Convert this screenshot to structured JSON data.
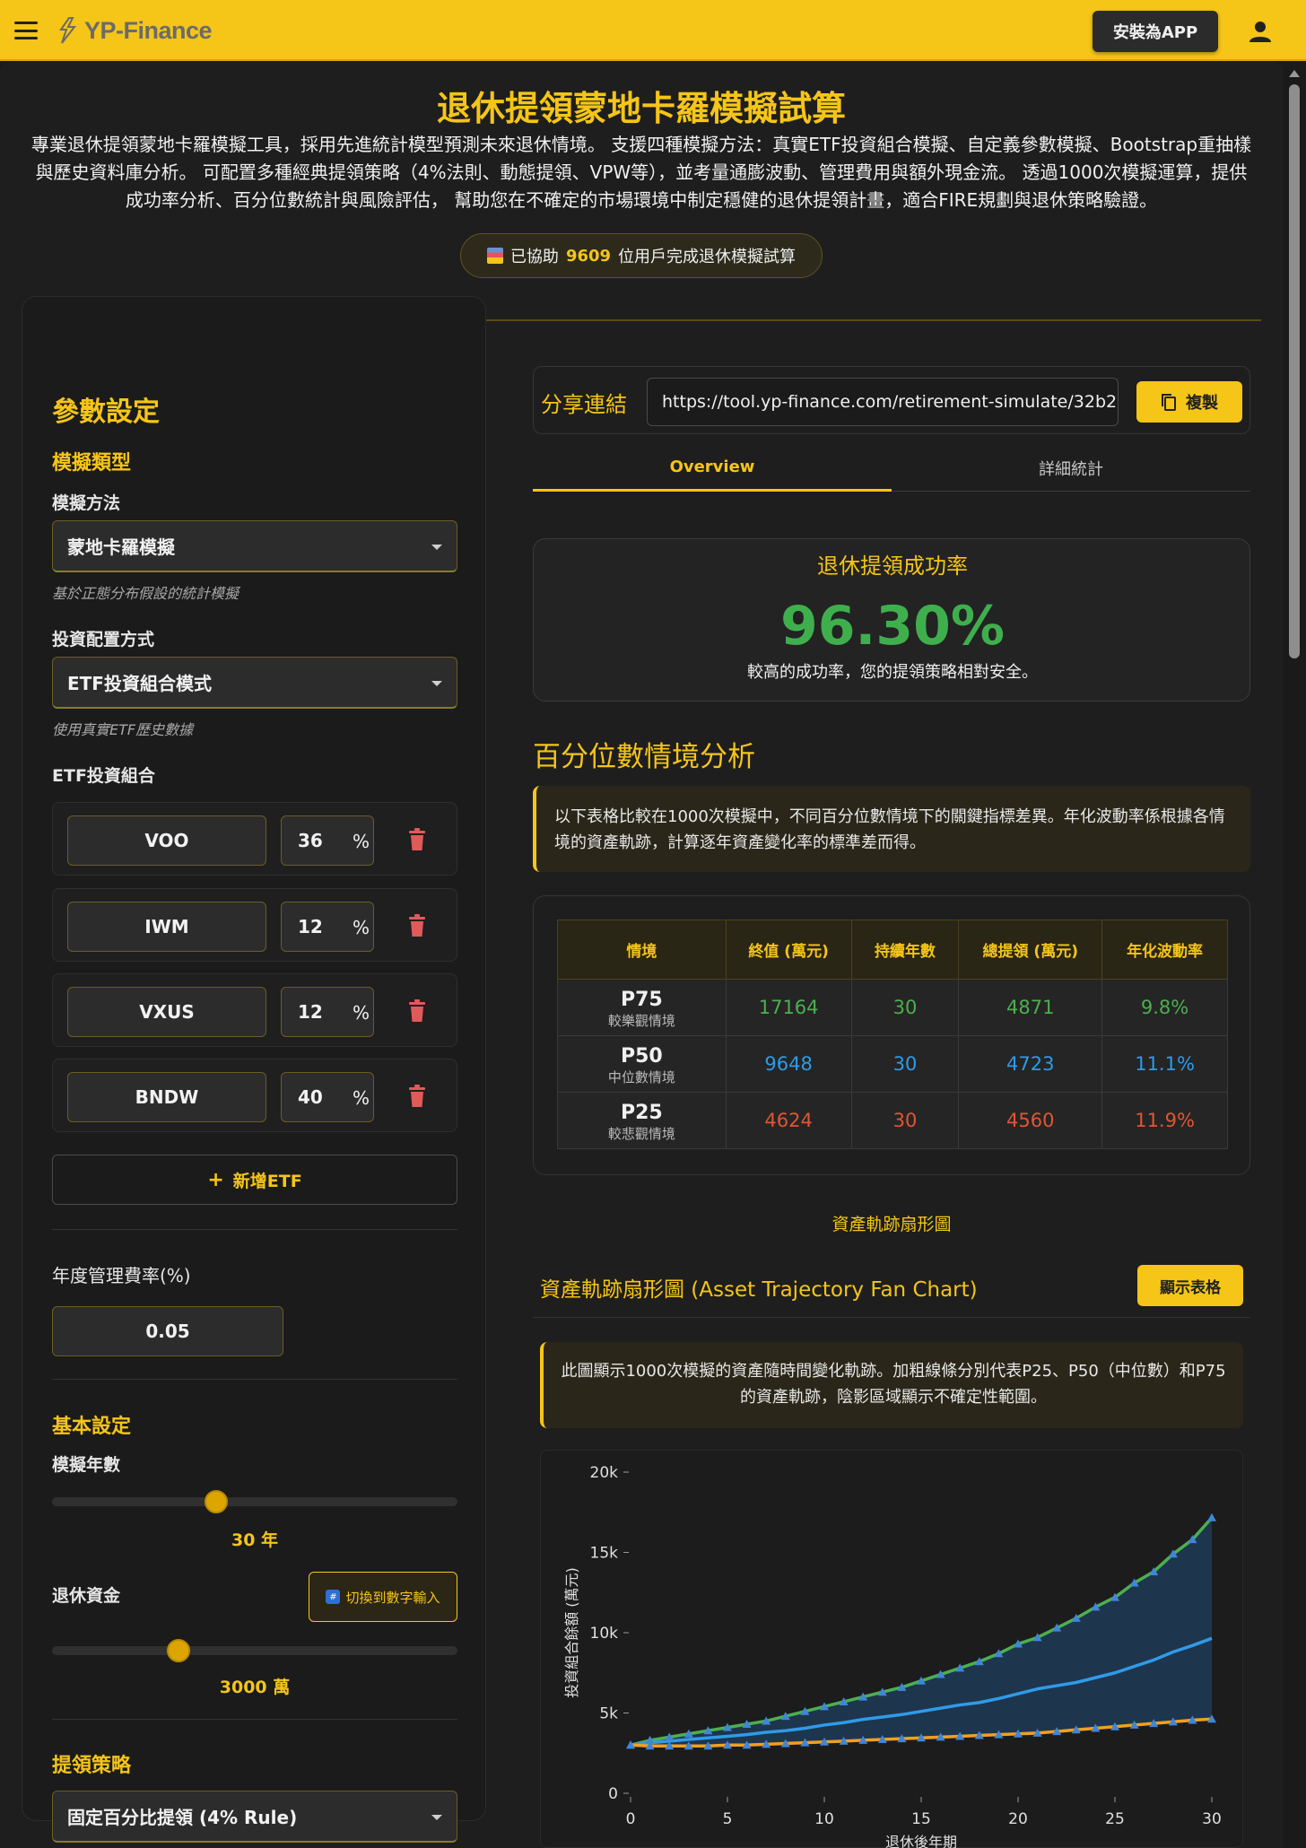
{
  "header": {
    "app_name": "YP-Finance",
    "install_label": "安裝為APP"
  },
  "intro": {
    "title": "退休提領蒙地卡羅模擬試算",
    "description": "專業退休提領蒙地卡羅模擬工具，採用先進統計模型預測未來退休情境。 支援四種模擬方法：真實ETF投資組合模擬、自定義參數模擬、Bootstrap重抽樣與歷史資料庫分析。 可配置多種經典提領策略（4%法則、動態提領、VPW等），並考量通膨波動、管理費用與額外現金流。 透過1000次模擬運算，提供成功率分析、百分位數統計與風險評估， 幫助您在不確定的市場環境中制定穩健的退休提領計畫，適合FIRE規劃與退休策略驗證。",
    "badge_prefix": "已協助",
    "badge_count": "9609",
    "badge_suffix": "位用戶完成退休模擬試算"
  },
  "params": {
    "title": "參數設定",
    "sim_type_title": "模擬類型",
    "method_label": "模擬方法",
    "method_value": "蒙地卡羅模擬",
    "method_hint": "基於正態分布假設的統計模擬",
    "alloc_label": "投資配置方式",
    "alloc_value": "ETF投資組合模式",
    "alloc_hint": "使用真實ETF歷史數據",
    "etf_label": "ETF投資組合",
    "etfs": [
      {
        "name": "VOO",
        "pct": "36"
      },
      {
        "name": "IWM",
        "pct": "12"
      },
      {
        "name": "VXUS",
        "pct": "12"
      },
      {
        "name": "BNDW",
        "pct": "40"
      }
    ],
    "pct_sign": "%",
    "add_etf_label": "新增ETF",
    "fee_label": "年度管理費率(%)",
    "fee_value": "0.05",
    "basic_title": "基本設定",
    "years_label": "模擬年數",
    "years_value": "30 年",
    "years_fraction": 0.4,
    "capital_label": "退休資金",
    "switch_label": "切換到數字輸入",
    "capital_value": "3000 萬",
    "capital_fraction": 0.3,
    "strategy_title": "提領策略",
    "strategy_value": "固定百分比提領 (4% Rule)"
  },
  "share": {
    "label": "分享連結",
    "url": "https://tool.yp-finance.com/retirement-simulate/32b2dfe",
    "copy_label": "複製"
  },
  "tabs": [
    {
      "label": "Overview"
    },
    {
      "label": "詳細統計"
    }
  ],
  "success": {
    "title": "退休提領成功率",
    "value": "96.30%",
    "note": "較高的成功率，您的提領策略相對安全。"
  },
  "percentile": {
    "title": "百分位數情境分析",
    "info": "以下表格比較在1000次模擬中，不同百分位數情境下的關鍵指標差異。年化波動率係根據各情境的資產軌跡，計算逐年資產變化率的標準差而得。",
    "headers": [
      "情境",
      "終值 (萬元)",
      "持續年數",
      "總提領 (萬元)",
      "年化波動率"
    ],
    "rows": [
      {
        "code": "P75",
        "name": "較樂觀情境",
        "final": "17164",
        "years": "30",
        "total": "4871",
        "vol": "9.8%"
      },
      {
        "code": "P50",
        "name": "中位數情境",
        "final": "9648",
        "years": "30",
        "total": "4723",
        "vol": "11.1%"
      },
      {
        "code": "P25",
        "name": "較悲觀情境",
        "final": "4624",
        "years": "30",
        "total": "4560",
        "vol": "11.9%"
      }
    ]
  },
  "fan": {
    "section_label": "資產軌跡扇形圖",
    "chart_title": "資產軌跡扇形圖 (Asset Trajectory Fan Chart)",
    "show_table_label": "顯示表格",
    "info": "此圖顯示1000次模擬的資產隨時間變化軌跡。加粗線條分別代表P25、P50（中位數）和P75的資產軌跡，陰影區域顯示不確定性範圍。"
  },
  "colors": {
    "accent": "#f5c518",
    "p75": "#4caf50",
    "p50": "#2f9be8",
    "p25": "#f0a020"
  },
  "chart_data": {
    "type": "line",
    "title": "",
    "xlabel": "退休後年期",
    "ylabel": "投資組合餘額 (萬元)",
    "xlim": [
      0,
      30
    ],
    "ylim": [
      0,
      20000
    ],
    "x_ticks": [
      0,
      5,
      10,
      15,
      20,
      25,
      30
    ],
    "y_ticks": [
      {
        "value": 0,
        "label": "0"
      },
      {
        "value": 5000,
        "label": "5k"
      },
      {
        "value": 10000,
        "label": "10k"
      },
      {
        "value": 15000,
        "label": "15k"
      },
      {
        "value": 20000,
        "label": "20k"
      }
    ],
    "x": [
      0,
      1,
      2,
      3,
      4,
      5,
      6,
      7,
      8,
      9,
      10,
      11,
      12,
      13,
      14,
      15,
      16,
      17,
      18,
      19,
      20,
      21,
      22,
      23,
      24,
      25,
      26,
      27,
      28,
      29,
      30
    ],
    "series": [
      {
        "values": [
          3000,
          3300,
          3500,
          3700,
          3900,
          4100,
          4300,
          4500,
          4800,
          5100,
          5400,
          5700,
          6000,
          6300,
          6600,
          7000,
          7400,
          7800,
          8200,
          8700,
          9300,
          9700,
          10300,
          10900,
          11600,
          12200,
          13100,
          13800,
          14900,
          15800,
          17164
        ]
      },
      {
        "values": [
          3000,
          3150,
          3250,
          3350,
          3450,
          3550,
          3650,
          3800,
          3900,
          4050,
          4250,
          4400,
          4600,
          4750,
          4900,
          5100,
          5300,
          5500,
          5650,
          5900,
          6200,
          6500,
          6700,
          6900,
          7200,
          7500,
          7900,
          8300,
          8800,
          9200,
          9648
        ]
      },
      {
        "values": [
          3000,
          2950,
          2950,
          2950,
          2950,
          3000,
          3000,
          3050,
          3100,
          3150,
          3200,
          3250,
          3300,
          3350,
          3400,
          3450,
          3500,
          3550,
          3600,
          3650,
          3700,
          3750,
          3850,
          3950,
          4050,
          4150,
          4250,
          4350,
          4450,
          4550,
          4624
        ]
      }
    ]
  }
}
